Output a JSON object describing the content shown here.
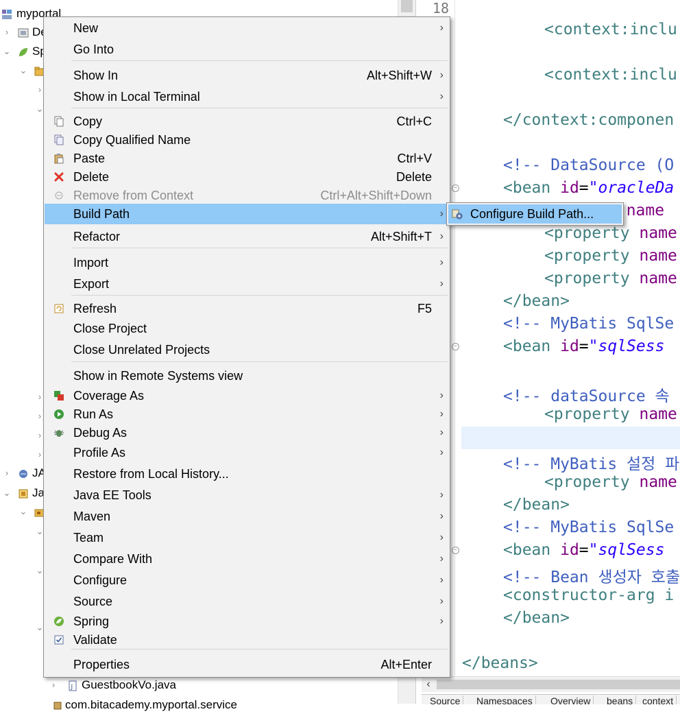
{
  "explorer": {
    "rows": [
      {
        "label": "myportal",
        "twisty": "",
        "icon": "web-project-icon"
      },
      {
        "label": "De",
        "twisty": "›",
        "icon": "deployment-descriptor-icon"
      },
      {
        "label": "Sp",
        "twisty": "⌄",
        "icon": "spring-elements-icon"
      },
      {
        "label": "",
        "twisty": "⌄",
        "icon": "package-folder-icon"
      },
      {
        "label": "JA",
        "twisty": "›",
        "icon": "jax-ws-icon"
      },
      {
        "label": "Ja",
        "twisty": "⌄",
        "icon": "java-resources-icon"
      },
      {
        "label": "",
        "twisty": "⌄",
        "icon": "source-folder-icon"
      },
      {
        "label": "GuestbookVo.java",
        "twisty": "›",
        "icon": "java-file-icon"
      },
      {
        "label": "com.bitacademy.myportal.service",
        "twisty": "",
        "icon": "package-icon"
      }
    ]
  },
  "editor": {
    "line_number": "18",
    "lines": [
      {
        "indent": "    ",
        "parts": [
          {
            "t": "<context:inclu",
            "c": "tag"
          }
        ]
      },
      {
        "indent": "    ",
        "parts": [
          {
            "t": "<context:inclu",
            "c": "tag"
          }
        ]
      },
      {
        "indent": "",
        "parts": [
          {
            "t": "</context:componen",
            "c": "tag"
          }
        ]
      },
      {
        "indent": "",
        "parts": [
          {
            "t": "<!-- DataSource (O",
            "c": "cmt"
          }
        ]
      },
      {
        "indent": "",
        "parts": [
          {
            "t": "<bean",
            "c": "tag"
          },
          {
            "t": " id",
            "c": "attr"
          },
          {
            "t": "=",
            "c": "pun"
          },
          {
            "t": "\"oracleDa",
            "c": "val"
          }
        ]
      },
      {
        "indent": "      ",
        "parts": [
          {
            "t": "y",
            "c": "tag"
          },
          {
            "t": " name",
            "c": "attr"
          }
        ]
      },
      {
        "indent": "    ",
        "parts": [
          {
            "t": "<property",
            "c": "tag"
          },
          {
            "t": " name",
            "c": "attr"
          }
        ]
      },
      {
        "indent": "    ",
        "parts": [
          {
            "t": "<property",
            "c": "tag"
          },
          {
            "t": " name",
            "c": "attr"
          }
        ]
      },
      {
        "indent": "    ",
        "parts": [
          {
            "t": "<property",
            "c": "tag"
          },
          {
            "t": " name",
            "c": "attr"
          }
        ]
      },
      {
        "indent": "",
        "parts": [
          {
            "t": "</bean>",
            "c": "tag"
          }
        ]
      },
      {
        "indent": "",
        "parts": [
          {
            "t": "<!-- MyBatis SqlSe",
            "c": "cmt"
          }
        ]
      },
      {
        "indent": "",
        "parts": [
          {
            "t": "<bean",
            "c": "tag"
          },
          {
            "t": " id",
            "c": "attr"
          },
          {
            "t": "=",
            "c": "pun"
          },
          {
            "t": "\"sqlSess",
            "c": "val"
          }
        ]
      },
      {
        "indent": "",
        "parts": [
          {
            "t": "<!-- dataSource 속",
            "c": "cmt"
          }
        ]
      },
      {
        "indent": "    ",
        "parts": [
          {
            "t": "<property",
            "c": "tag"
          },
          {
            "t": " name",
            "c": "attr"
          }
        ]
      },
      {
        "indent": "",
        "parts": [
          {
            "t": "<!-- MyBatis 설정 파",
            "c": "cmt"
          }
        ]
      },
      {
        "indent": "    ",
        "parts": [
          {
            "t": "<property",
            "c": "tag"
          },
          {
            "t": " name",
            "c": "attr"
          }
        ]
      },
      {
        "indent": "",
        "parts": [
          {
            "t": "</bean>",
            "c": "tag"
          }
        ]
      },
      {
        "indent": "",
        "parts": [
          {
            "t": "<!-- MyBatis SqlSe",
            "c": "cmt"
          }
        ]
      },
      {
        "indent": "",
        "parts": [
          {
            "t": "<bean",
            "c": "tag"
          },
          {
            "t": " id",
            "c": "attr"
          },
          {
            "t": "=",
            "c": "pun"
          },
          {
            "t": "\"sqlSess",
            "c": "val"
          }
        ]
      },
      {
        "indent": "",
        "parts": [
          {
            "t": "<!-- Bean 생성자 호출",
            "c": "cmt"
          }
        ]
      },
      {
        "indent": "",
        "parts": [
          {
            "t": "<constructor-arg i",
            "c": "tag"
          }
        ]
      },
      {
        "indent": "",
        "parts": [
          {
            "t": "</bean>",
            "c": "tag"
          }
        ]
      },
      {
        "indent": "",
        "parts": [
          {
            "t": "</beans>",
            "c": "tag"
          }
        ]
      }
    ],
    "bottom_tabs": [
      "Source",
      "Namespaces",
      "Overview",
      "beans",
      "context"
    ]
  },
  "context_menu": {
    "items": [
      {
        "label": "New",
        "shortcut": "",
        "submenu": true,
        "icon": ""
      },
      {
        "label": "Go Into",
        "shortcut": "",
        "submenu": false,
        "icon": ""
      },
      {
        "label": "Show In",
        "shortcut": "Alt+Shift+W",
        "submenu": true,
        "icon": ""
      },
      {
        "label": "Show in Local Terminal",
        "shortcut": "",
        "submenu": true,
        "icon": ""
      },
      {
        "label": "Copy",
        "shortcut": "Ctrl+C",
        "submenu": false,
        "icon": "copy-icon"
      },
      {
        "label": "Copy Qualified Name",
        "shortcut": "",
        "submenu": false,
        "icon": "copy-qualified-name-icon"
      },
      {
        "label": "Paste",
        "shortcut": "Ctrl+V",
        "submenu": false,
        "icon": "paste-icon"
      },
      {
        "label": "Delete",
        "shortcut": "Delete",
        "submenu": false,
        "icon": "delete-icon"
      },
      {
        "label": "Remove from Context",
        "shortcut": "Ctrl+Alt+Shift+Down",
        "submenu": false,
        "icon": "remove-from-context-icon",
        "disabled": true
      },
      {
        "label": "Build Path",
        "shortcut": "",
        "submenu": true,
        "icon": "",
        "highlighted": true
      },
      {
        "label": "Refactor",
        "shortcut": "Alt+Shift+T",
        "submenu": true,
        "icon": ""
      },
      {
        "label": "Import",
        "shortcut": "",
        "submenu": true,
        "icon": ""
      },
      {
        "label": "Export",
        "shortcut": "",
        "submenu": true,
        "icon": ""
      },
      {
        "label": "Refresh",
        "shortcut": "F5",
        "submenu": false,
        "icon": "refresh-icon"
      },
      {
        "label": "Close Project",
        "shortcut": "",
        "submenu": false,
        "icon": ""
      },
      {
        "label": "Close Unrelated Projects",
        "shortcut": "",
        "submenu": false,
        "icon": ""
      },
      {
        "label": "Show in Remote Systems view",
        "shortcut": "",
        "submenu": false,
        "icon": ""
      },
      {
        "label": "Coverage As",
        "shortcut": "",
        "submenu": true,
        "icon": "coverage-icon"
      },
      {
        "label": "Run As",
        "shortcut": "",
        "submenu": true,
        "icon": "run-icon"
      },
      {
        "label": "Debug As",
        "shortcut": "",
        "submenu": true,
        "icon": "debug-icon"
      },
      {
        "label": "Profile As",
        "shortcut": "",
        "submenu": true,
        "icon": ""
      },
      {
        "label": "Restore from Local History...",
        "shortcut": "",
        "submenu": false,
        "icon": ""
      },
      {
        "label": "Java EE Tools",
        "shortcut": "",
        "submenu": true,
        "icon": ""
      },
      {
        "label": "Maven",
        "shortcut": "",
        "submenu": true,
        "icon": ""
      },
      {
        "label": "Team",
        "shortcut": "",
        "submenu": true,
        "icon": ""
      },
      {
        "label": "Compare With",
        "shortcut": "",
        "submenu": true,
        "icon": ""
      },
      {
        "label": "Configure",
        "shortcut": "",
        "submenu": true,
        "icon": ""
      },
      {
        "label": "Source",
        "shortcut": "",
        "submenu": true,
        "icon": ""
      },
      {
        "label": "Spring",
        "shortcut": "",
        "submenu": true,
        "icon": "spring-icon"
      },
      {
        "label": "Validate",
        "shortcut": "",
        "submenu": false,
        "icon": "validate-icon"
      },
      {
        "label": "Properties",
        "shortcut": "Alt+Enter",
        "submenu": false,
        "icon": ""
      }
    ]
  },
  "submenu": {
    "label": "Configure Build Path...",
    "icon": "configure-build-path-icon"
  },
  "colors": {
    "highlight": "#91c9f7",
    "menu_bg": "#f2f2f2",
    "xml_tag": "#3f7f7f",
    "xml_attr": "#7f007f",
    "xml_value": "#2a00ff",
    "xml_comment": "#3f5fbf"
  }
}
